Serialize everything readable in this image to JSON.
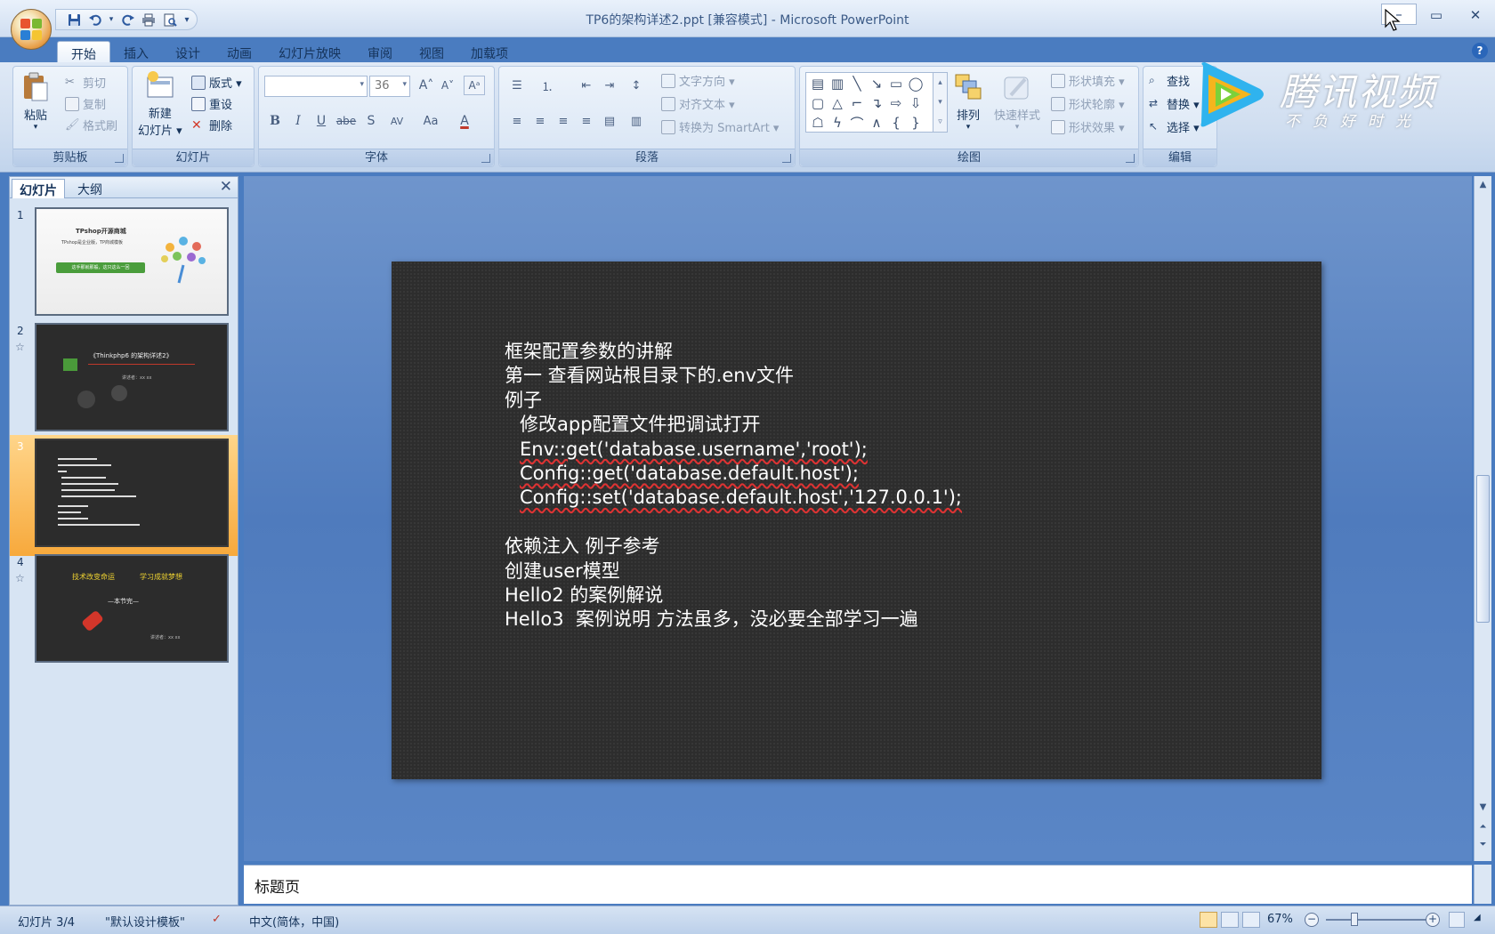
{
  "window": {
    "title": "TP6的架构详述2.ppt [兼容模式] - Microsoft PowerPoint",
    "min": "–",
    "max": "▭",
    "close": "✕"
  },
  "qat": {
    "save_icon": "save-icon",
    "undo_icon": "undo-icon",
    "redo_icon": "redo-icon",
    "print_icon": "print-icon",
    "preview_icon": "print-preview-icon",
    "customize": "▾"
  },
  "tabs": [
    "开始",
    "插入",
    "设计",
    "动画",
    "幻灯片放映",
    "审阅",
    "视图",
    "加载项"
  ],
  "help": "?",
  "ribbon": {
    "clipboard": {
      "label": "剪贴板",
      "paste": "粘贴",
      "cut": "剪切",
      "copy": "复制",
      "format_painter": "格式刷"
    },
    "slides": {
      "label": "幻灯片",
      "new_slide_1": "新建",
      "new_slide_2": "幻灯片 ▾",
      "layout": "版式 ▾",
      "reset": "重设",
      "delete": "删除"
    },
    "font": {
      "label": "字体",
      "font_name": "",
      "font_size": "36",
      "grow": "A˄",
      "shrink": "A˅",
      "clear": "Aᵃ",
      "bold": "B",
      "italic": "I",
      "underline": "U",
      "strike": "abe",
      "shadow": "S",
      "spacing": "AV",
      "case": "Aa",
      "color": "A"
    },
    "paragraph": {
      "label": "段落",
      "text_direction": "文字方向 ▾",
      "align_text": "对齐文本 ▾",
      "smartart": "转换为 SmartArt ▾"
    },
    "drawing": {
      "label": "绘图",
      "arrange": "排列",
      "quick_styles": "快速样式",
      "shape_fill": "形状填充 ▾",
      "shape_outline": "形状轮廓 ▾",
      "shape_effects": "形状效果 ▾"
    },
    "editing": {
      "label": "编辑",
      "find": "查找",
      "replace": "替换 ▾",
      "select": "选择 ▾"
    }
  },
  "left_panel": {
    "tab_slides": "幻灯片",
    "tab_outline": "大纲",
    "close": "✕",
    "thumbs": [
      {
        "num": "1",
        "title": "TPshop开源商城",
        "sub": "TPshop是企业版，TP商城模板",
        "banner": "这手那就那般，这只这么一回"
      },
      {
        "num": "2",
        "title": "《Thinkphp6 的架构详述2》",
        "sub": "讲述者：xx   xx"
      },
      {
        "num": "3"
      },
      {
        "num": "4",
        "title1": "技术改变命运",
        "title2": "学习成就梦想",
        "sub": "—本节完—",
        "sub2": "讲述者：xx   xx"
      }
    ]
  },
  "slide": {
    "lines": [
      {
        "text": "框架配置参数的讲解",
        "indent": 0
      },
      {
        "text": "第一 查看网站根目录下的.env文件",
        "indent": 0
      },
      {
        "text": "例子",
        "indent": 0
      },
      {
        "text": "修改app配置文件把调试打开",
        "indent": 1
      },
      {
        "text": "Env::get('database.username','root');",
        "indent": 1
      },
      {
        "text": "Config::get('database.default.host');",
        "indent": 1
      },
      {
        "text": "Config::set('database.default.host','127.0.0.1');",
        "indent": 1
      },
      {
        "text": "",
        "indent": 0
      },
      {
        "text": "依赖注入 例子参考",
        "indent": 0
      },
      {
        "text": "创建user模型",
        "indent": 0
      },
      {
        "text": "Hello2 的案例解说",
        "indent": 0
      },
      {
        "text": "Hello3  案例说明 方法虽多，没必要全部学习一遍",
        "indent": 0
      }
    ]
  },
  "notes": {
    "text": "标题页"
  },
  "status": {
    "slide_count": "幻灯片 3/4",
    "template": "\"默认设计模板\"",
    "language": "中文(简体，中国)",
    "zoom": "67%",
    "zoom_out": "−",
    "zoom_in": "+"
  },
  "watermark": {
    "brand": "腾讯视频",
    "slogan": "不负好时光"
  }
}
